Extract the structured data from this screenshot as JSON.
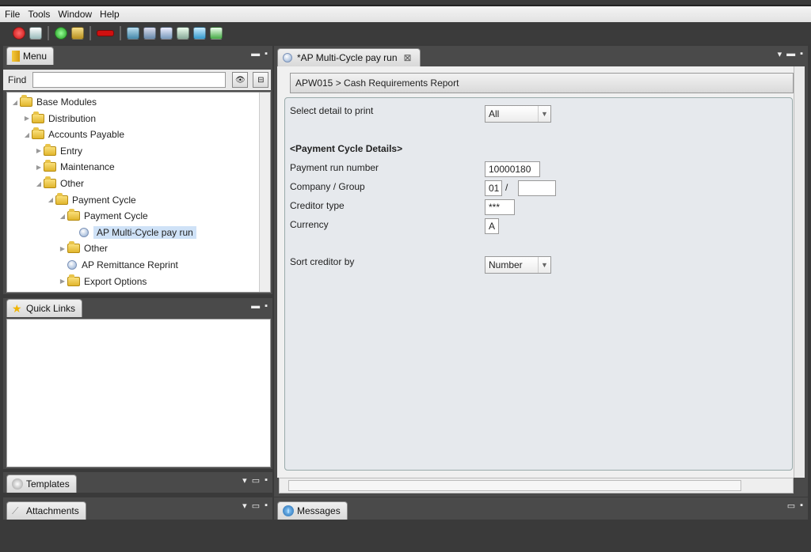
{
  "menubar": {
    "file": "File",
    "tools": "Tools",
    "window": "Window",
    "help": "Help"
  },
  "toolbar": {
    "icons": [
      "power-icon",
      "print-icon",
      "refresh-icon",
      "export-icon",
      "stop-icon",
      "run-icon",
      "save-icon",
      "preview-icon",
      "schedule-icon",
      "task-icon",
      "check-icon"
    ]
  },
  "menu_panel": {
    "tab": "Menu",
    "find_label": "Find",
    "find_value": ""
  },
  "tree": [
    {
      "label": "Base Modules",
      "indent": 0,
      "state": "open",
      "icon": "folder"
    },
    {
      "label": "Distribution",
      "indent": 1,
      "state": "closed",
      "icon": "folder"
    },
    {
      "label": "Accounts Payable",
      "indent": 1,
      "state": "open",
      "icon": "folder"
    },
    {
      "label": "Entry",
      "indent": 2,
      "state": "closed",
      "icon": "folder"
    },
    {
      "label": "Maintenance",
      "indent": 2,
      "state": "closed",
      "icon": "folder"
    },
    {
      "label": "Other",
      "indent": 2,
      "state": "open",
      "icon": "folder"
    },
    {
      "label": "Payment Cycle",
      "indent": 3,
      "state": "open",
      "icon": "folder"
    },
    {
      "label": "Payment Cycle",
      "indent": 4,
      "state": "open",
      "icon": "folder"
    },
    {
      "label": "AP Multi-Cycle pay run",
      "indent": 5,
      "state": "leaf",
      "icon": "process",
      "selected": true
    },
    {
      "label": "Other",
      "indent": 4,
      "state": "closed",
      "icon": "folder"
    },
    {
      "label": "AP Remittance Reprint",
      "indent": 4,
      "state": "leaf",
      "icon": "process"
    },
    {
      "label": "Export Options",
      "indent": 4,
      "state": "closed",
      "icon": "folder"
    }
  ],
  "quick_links": {
    "tab": "Quick Links"
  },
  "templates": {
    "tab": "Templates"
  },
  "attachments": {
    "tab": "Attachments"
  },
  "messages": {
    "tab": "Messages"
  },
  "editor": {
    "tab": "*AP Multi-Cycle pay run",
    "breadcrumb": "APW015 > Cash Requirements Report"
  },
  "form": {
    "select_detail_label": "Select detail to print",
    "select_detail_value": "All",
    "section_title": "<Payment Cycle Details>",
    "payment_run_label": "Payment run number",
    "payment_run_value": "10000180",
    "company_label": "Company / Group",
    "company_value": "01",
    "group_sep": "/",
    "group_value": "",
    "creditor_type_label": "Creditor type",
    "creditor_type_value": "***",
    "currency_label": "Currency",
    "currency_value": "A",
    "sort_label": "Sort creditor by",
    "sort_value": "Number"
  },
  "colors": {
    "accent_selection": "#cfe2f7",
    "chrome_dark": "#3a3a3a",
    "form_bg": "#e6e9ed"
  }
}
